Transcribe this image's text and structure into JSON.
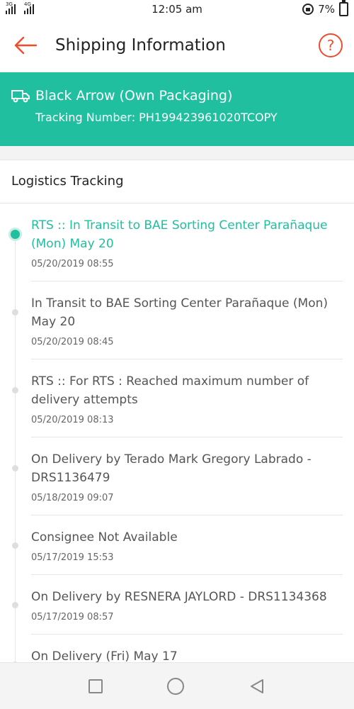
{
  "status_bar": {
    "time": "12:05 am",
    "battery": "7%",
    "network_1": "3G",
    "network_2": "4G"
  },
  "header": {
    "title": "Shipping Information",
    "help_symbol": "?",
    "back_icon": "arrow-left-icon",
    "accent_color": "#ee4d2d"
  },
  "shipment": {
    "carrier": "Black Arrow (Own Packaging)",
    "tracking": "Tracking Number: PH199423961020TCOPY",
    "banner_color": "#1fbf9f",
    "icon": "truck-icon"
  },
  "logistics": {
    "title": "Logistics Tracking",
    "events": [
      {
        "desc": "RTS :: In Transit to BAE Sorting Center Parañaque (Mon) May 20",
        "time": "05/20/2019 08:55"
      },
      {
        "desc": "In Transit to BAE Sorting Center Parañaque (Mon) May 20",
        "time": "05/20/2019 08:45"
      },
      {
        "desc": "RTS :: For RTS : Reached maximum number of delivery attempts",
        "time": "05/20/2019 08:13"
      },
      {
        "desc": "On Delivery by Terado Mark Gregory Labrado - DRS1136479",
        "time": "05/18/2019 09:07"
      },
      {
        "desc": "Consignee Not Available",
        "time": "05/17/2019 15:53"
      },
      {
        "desc": "On Delivery by RESNERA JAYLORD - DRS1134368",
        "time": "05/17/2019 08:57"
      },
      {
        "desc": "On Delivery (Fri) May 17",
        "time": ""
      }
    ]
  }
}
